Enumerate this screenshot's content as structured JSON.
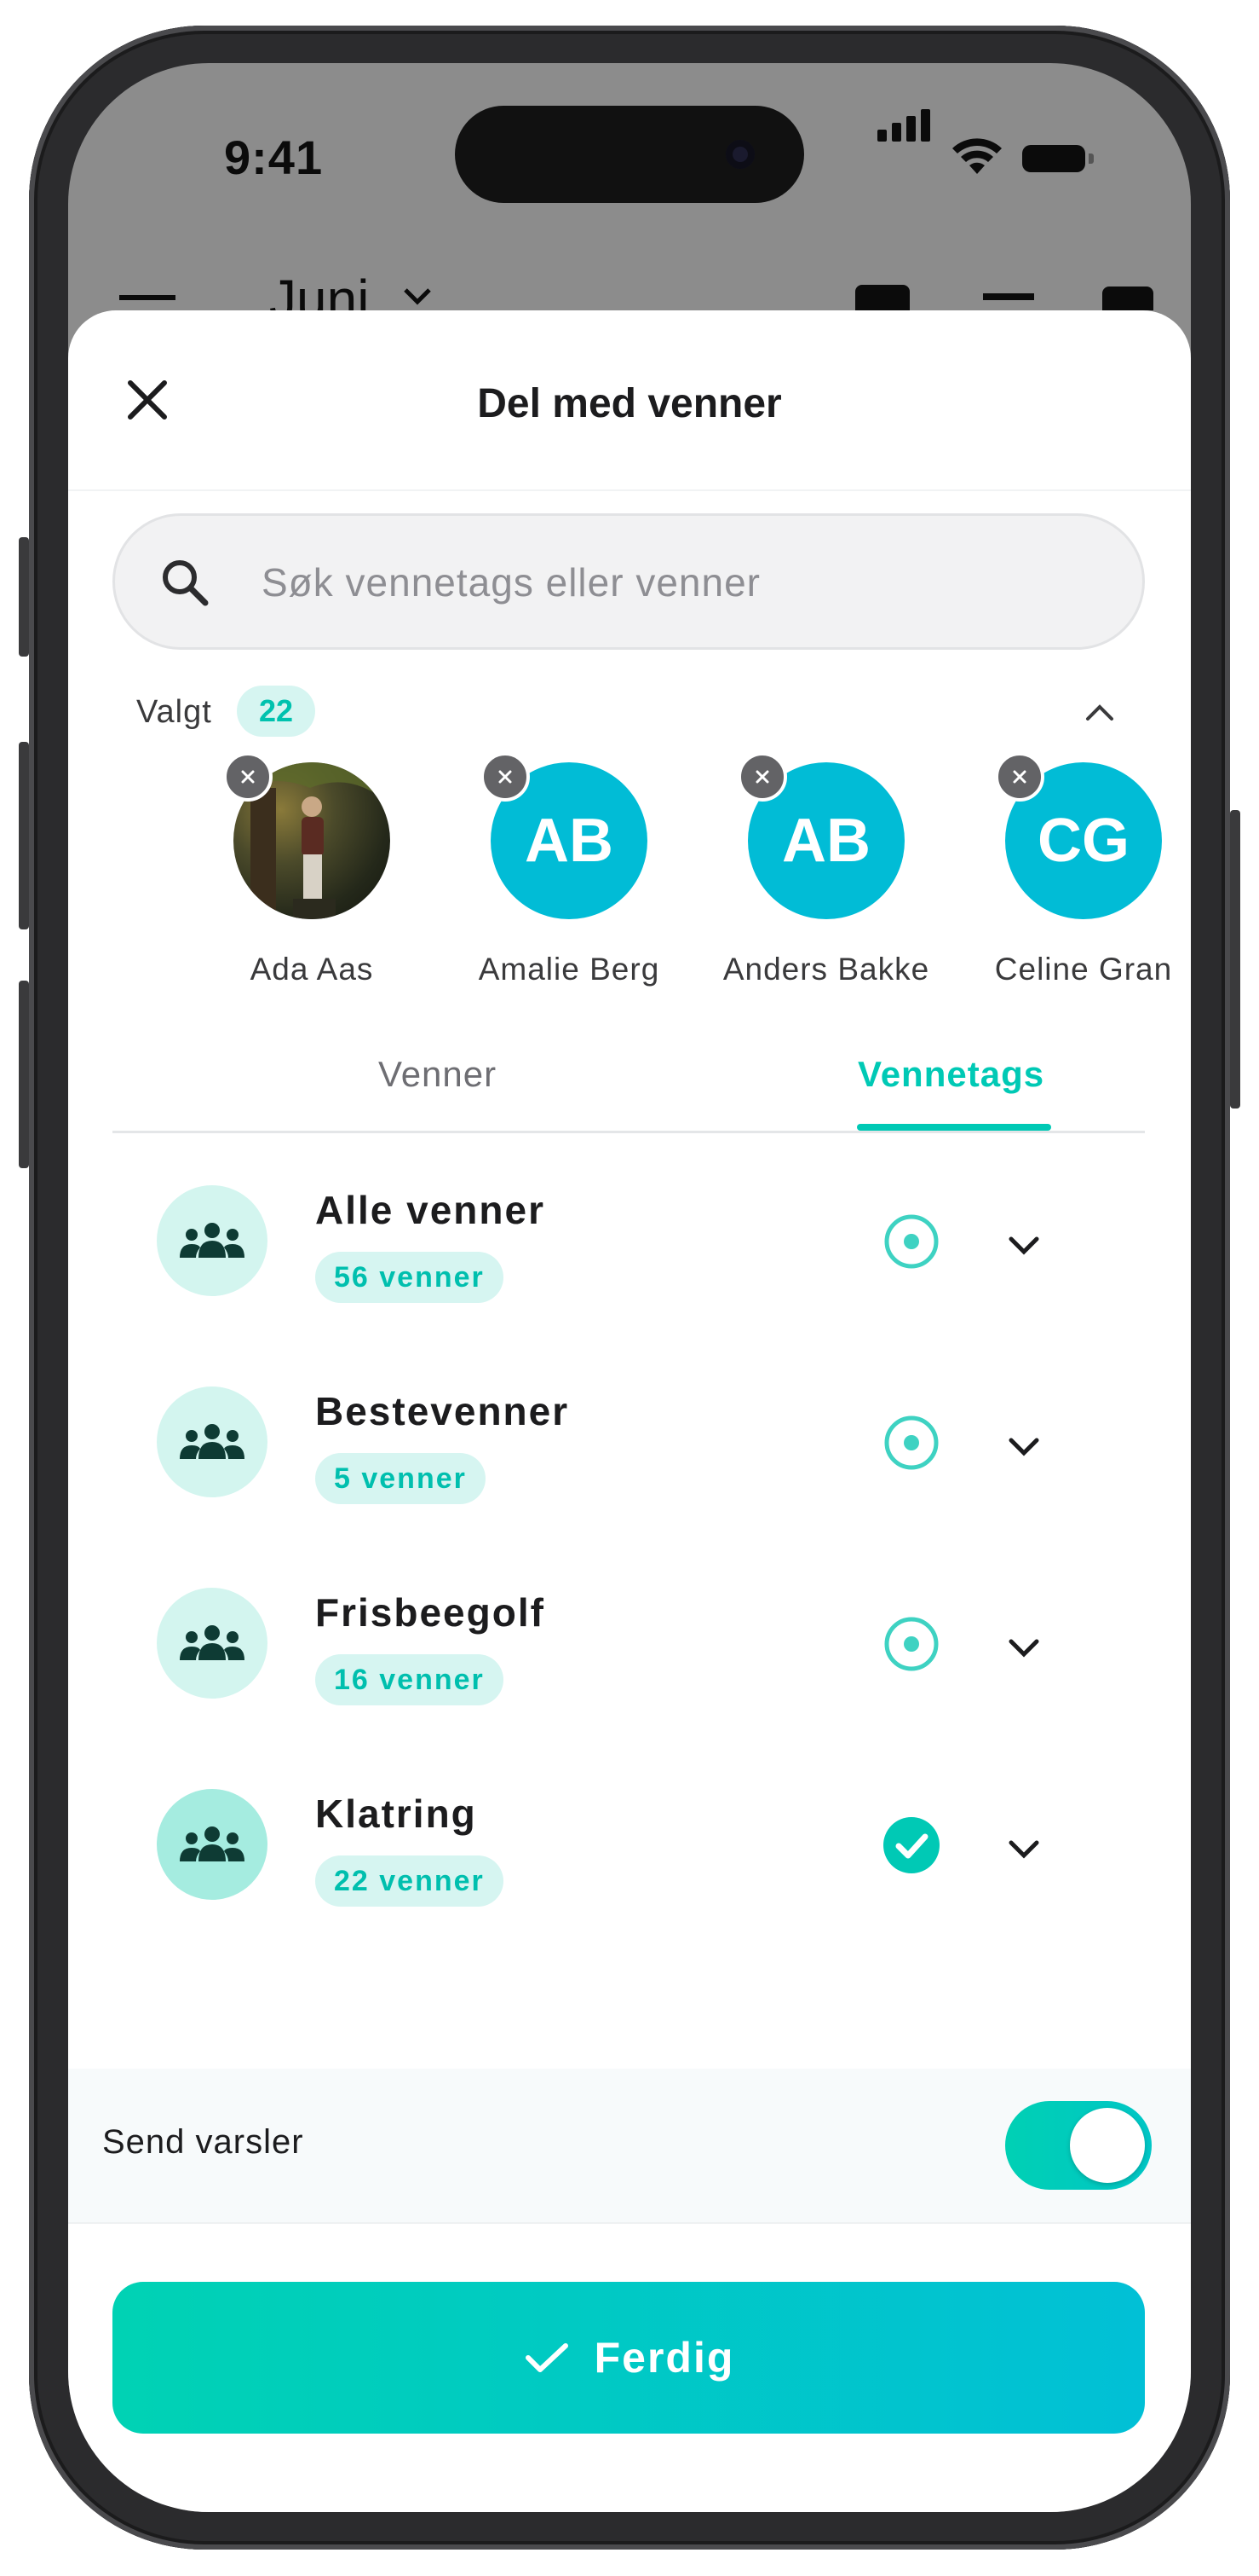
{
  "status_bar": {
    "time": "9:41"
  },
  "background_screen": {
    "month_label": "Juni"
  },
  "sheet": {
    "title": "Del med venner",
    "search": {
      "placeholder": "Søk vennetags eller venner",
      "value": ""
    },
    "selected": {
      "label": "Valgt",
      "count": "22",
      "people": [
        {
          "name": "Ada Aas",
          "initials": "",
          "has_photo": true
        },
        {
          "name": "Amalie Berg",
          "initials": "AB",
          "has_photo": false
        },
        {
          "name": "Anders Bakke",
          "initials": "AB",
          "has_photo": false
        },
        {
          "name": "Celine Gran",
          "initials": "CG",
          "has_photo": false
        }
      ]
    },
    "tabs": [
      {
        "label": "Venner",
        "active": false
      },
      {
        "label": "Vennetags",
        "active": true
      }
    ],
    "tags": [
      {
        "name": "Alle venner",
        "count": "56 venner",
        "state": "partial"
      },
      {
        "name": "Bestevenner",
        "count": "5 venner",
        "state": "partial"
      },
      {
        "name": "Frisbeegolf",
        "count": "16 venner",
        "state": "partial"
      },
      {
        "name": "Klatring",
        "count": "22 venner",
        "state": "selected"
      }
    ],
    "notifications": {
      "label": "Send varsler",
      "enabled": true
    },
    "done_button": {
      "label": "Ferdig"
    }
  },
  "colors": {
    "accent": "#00c9b5",
    "avatar": "#01bcd6",
    "tag_bg": "#d6f5f1"
  }
}
